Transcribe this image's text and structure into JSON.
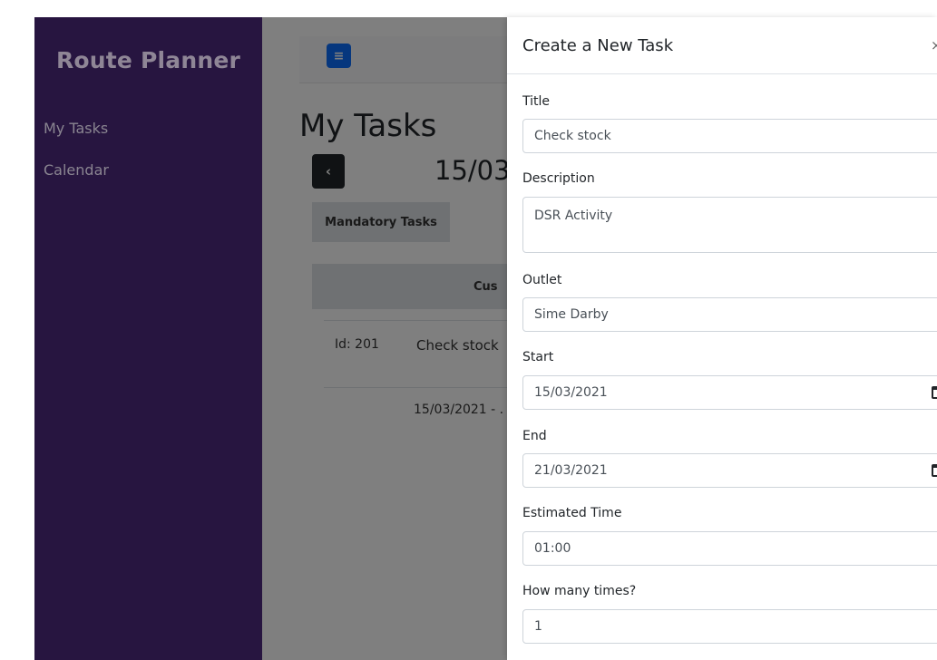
{
  "sidebar": {
    "brand": "Route Planner",
    "items": [
      {
        "label": "My Tasks"
      },
      {
        "label": "Calendar"
      }
    ]
  },
  "main": {
    "menu_icon": "≡",
    "title": "My Tasks",
    "prev_icon": "‹",
    "date_range": "15/03",
    "tab_label": "Mandatory Tasks",
    "table": {
      "header_customer": "Cus",
      "row": {
        "id": "Id: 201",
        "title": "Check stock",
        "dates": "15/03/2021 - ."
      }
    }
  },
  "panel": {
    "title": "Create a New Task",
    "close": "×",
    "fields": {
      "title_label": "Title",
      "title_value": "Check stock",
      "description_label": "Description",
      "description_value": "DSR Activity",
      "outlet_label": "Outlet",
      "outlet_value": "Sime Darby",
      "start_label": "Start",
      "start_value": "15/03/2021",
      "end_label": "End",
      "end_value": "21/03/2021",
      "estimated_label": "Estimated Time",
      "estimated_value": "01:00",
      "times_label": "How many times?",
      "times_value": "1"
    }
  },
  "colors": {
    "sidebar_bg": "#271540",
    "accent": "#0d6efd"
  }
}
